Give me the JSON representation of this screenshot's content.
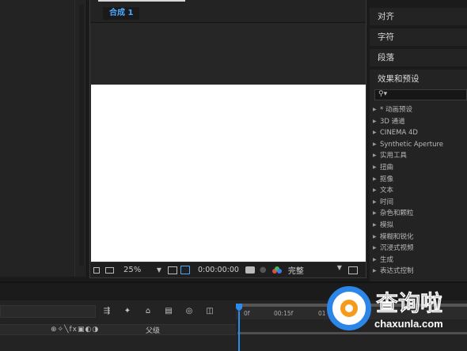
{
  "viewer": {
    "tab_label": "合成 1",
    "zoom": "25%",
    "timecode": "0:00:00:00",
    "resolution": "完整"
  },
  "right_panels": {
    "align": "对齐",
    "character": "字符",
    "paragraph": "段落",
    "effects_title": "效果和预设",
    "search_icon": "search-icon"
  },
  "effects": [
    "* 动画预设",
    "3D 通道",
    "CINEMA 4D",
    "Synthetic Aperture",
    "实用工具",
    "扭曲",
    "抠像",
    "文本",
    "时间",
    "杂色和颗粒",
    "模拟",
    "模糊和锐化",
    "沉浸式视频",
    "生成",
    "表达式控制"
  ],
  "timeline": {
    "parent_label": "父级",
    "ruler_ticks": [
      "0f",
      "00:15f",
      "01"
    ]
  },
  "watermark": {
    "name": "查询啦",
    "url": "chaxunla.com"
  },
  "colors": {
    "accent": "#2d8ceb",
    "tab_text": "#4da8ff",
    "logo_orange": "#f59a1b"
  }
}
